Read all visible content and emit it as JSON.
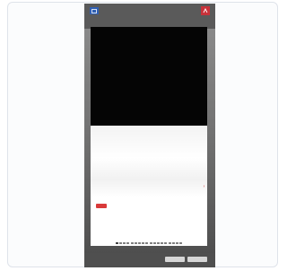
{
  "header": {
    "caption": "",
    "left_logo_icon": "flag-logo-icon",
    "right_logo_icon": "red-square-logo-icon"
  },
  "video": {
    "meta_line_1": "",
    "meta_line_2": ""
  },
  "article": {
    "tag": "",
    "headline": "",
    "body": "",
    "read_more": ""
  },
  "pager": {
    "pages": 18,
    "active_index": 0
  },
  "footer": {
    "line_1": "",
    "line_2": "",
    "line_3": "",
    "button_1": "",
    "button_2": ""
  },
  "colors": {
    "accent_red": "#d93a3a",
    "brand_blue": "#2f5fb3",
    "video_bg": "#050505"
  }
}
